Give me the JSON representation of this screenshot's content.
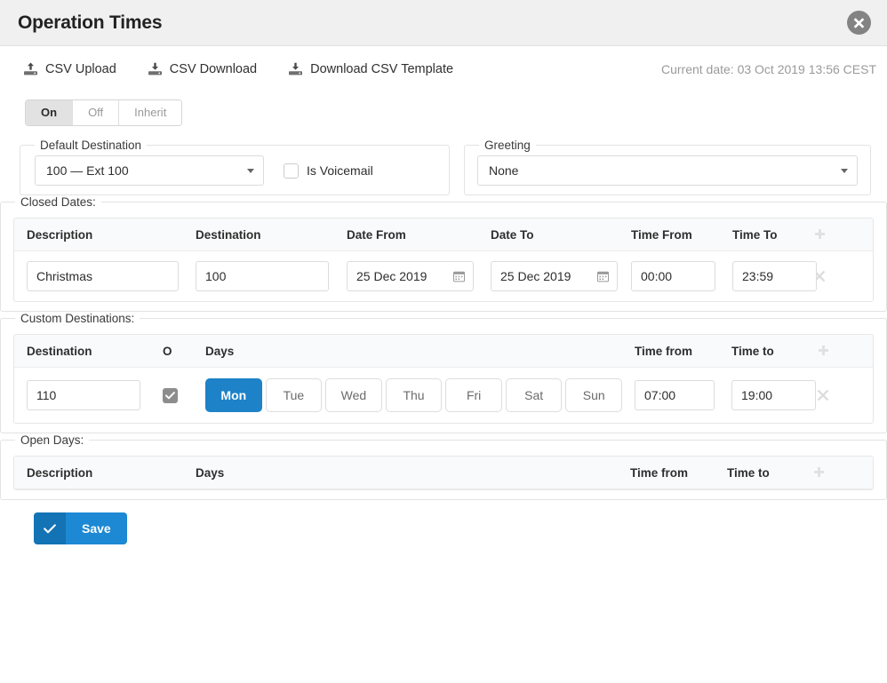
{
  "header": {
    "title": "Operation Times",
    "close_icon": "close-circle-icon"
  },
  "toolbar": {
    "csv_upload": "CSV Upload",
    "csv_download": "CSV Download",
    "csv_template": "Download CSV Template",
    "current_date": "Current date: 03 Oct 2019 13:56 CEST",
    "upload_icon": "upload-icon",
    "download_icon": "download-icon"
  },
  "state_toggle": {
    "options": [
      "On",
      "Off",
      "Inherit"
    ],
    "selected": "On"
  },
  "default_destination": {
    "legend": "Default Destination",
    "select_value": "100  —  Ext 100",
    "voicemail_label": "Is Voicemail",
    "voicemail_checked": false
  },
  "greeting": {
    "legend": "Greeting",
    "select_value": "None"
  },
  "closed_dates": {
    "legend": "Closed Dates:",
    "columns": [
      "Description",
      "Destination",
      "Date From",
      "Date To",
      "Time From",
      "Time To"
    ],
    "add_icon": "plus-icon",
    "rows": [
      {
        "description": "Christmas",
        "destination": "100",
        "date_from": "25 Dec 2019",
        "date_to": "25 Dec 2019",
        "time_from": "00:00",
        "time_to": "23:59",
        "remove_icon": "remove-x-icon",
        "calendar_icon": "calendar-icon"
      }
    ]
  },
  "custom_destinations": {
    "legend": "Custom Destinations:",
    "columns": [
      "Destination",
      "O",
      "Days",
      "Time from",
      "Time to"
    ],
    "add_icon": "plus-icon",
    "day_labels": [
      "Mon",
      "Tue",
      "Wed",
      "Thu",
      "Fri",
      "Sat",
      "Sun"
    ],
    "rows": [
      {
        "destination": "110",
        "o_checked": true,
        "selected_days": [
          "Mon"
        ],
        "time_from": "07:00",
        "time_to": "19:00",
        "remove_icon": "remove-x-icon"
      }
    ]
  },
  "open_days": {
    "legend": "Open Days:",
    "columns": [
      "Description",
      "Days",
      "Time from",
      "Time to"
    ],
    "add_icon": "plus-icon",
    "rows": []
  },
  "footer": {
    "save_label": "Save",
    "save_icon": "check-icon"
  },
  "colors": {
    "accent_blue": "#1d82c8",
    "save_blue": "#1d88d3",
    "save_blue_dark": "#1373b5",
    "header_bg": "#f0f0f0",
    "checkbox_gray": "#8d8d8d",
    "muted_text": "#9a9a9a"
  }
}
